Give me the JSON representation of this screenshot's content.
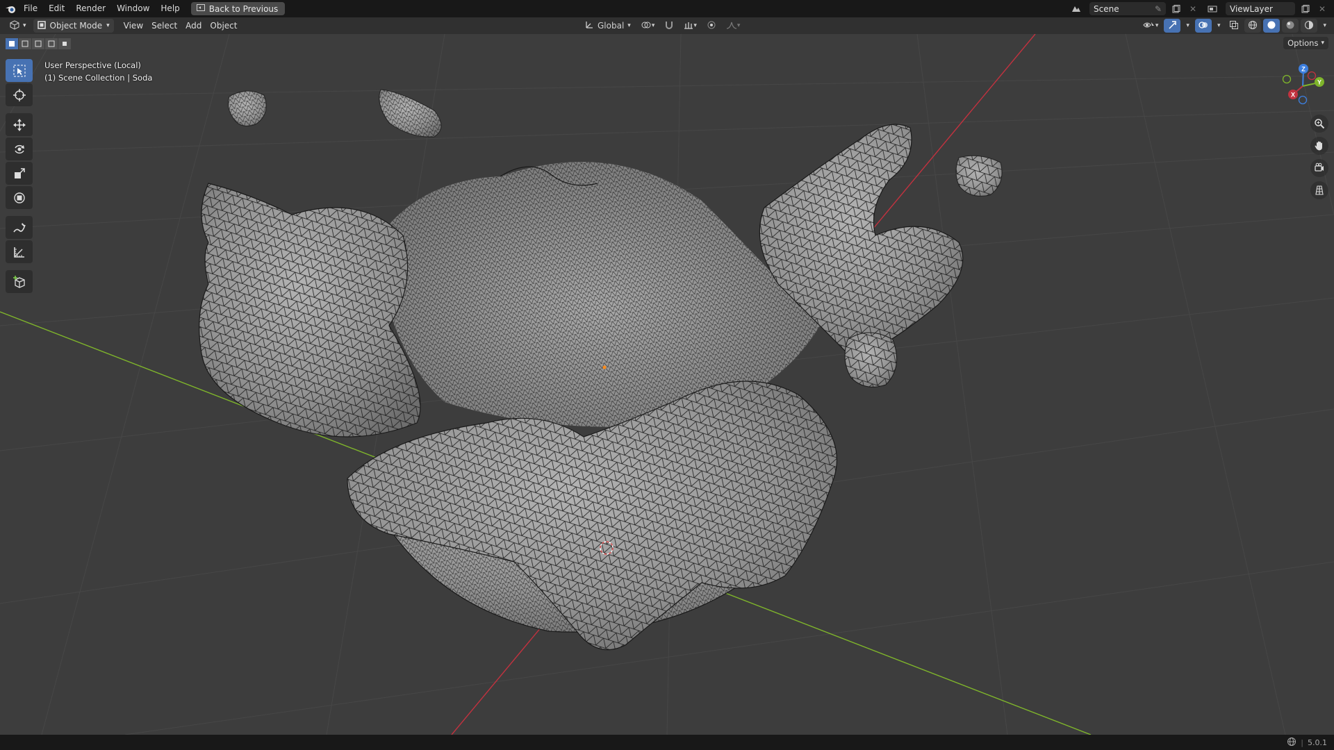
{
  "app": {
    "name": "Blender",
    "logo_icon": "blender-logo-icon"
  },
  "menu": [
    "File",
    "Edit",
    "Render",
    "Window",
    "Help"
  ],
  "back_button": {
    "label": "Back to Previous",
    "icon": "back-screen-icon"
  },
  "scene": {
    "name": "Scene"
  },
  "view_layer": {
    "name": "ViewLayer"
  },
  "viewport_header": {
    "editor_icon": "3d-viewport-icon",
    "mode": "Object Mode",
    "menus": [
      "View",
      "Select",
      "Add",
      "Object"
    ],
    "transform_orientation": "Global"
  },
  "overlay_info": {
    "view": "User Perspective (Local)",
    "collection": "(1) Scene Collection | Soda"
  },
  "options_label": "Options",
  "tools": [
    {
      "name": "select-box",
      "icon": "select-box-icon",
      "active": true
    },
    {
      "name": "cursor",
      "icon": "cursor-icon",
      "active": false
    },
    {
      "name": "move",
      "icon": "move-icon",
      "active": false
    },
    {
      "name": "rotate",
      "icon": "rotate-icon",
      "active": false
    },
    {
      "name": "scale",
      "icon": "scale-icon",
      "active": false
    },
    {
      "name": "transform",
      "icon": "transform-icon",
      "active": false
    },
    {
      "name": "annotate",
      "icon": "annotate-icon",
      "active": false
    },
    {
      "name": "measure",
      "icon": "measure-icon",
      "active": false
    },
    {
      "name": "add-cube",
      "icon": "add-cube-icon",
      "active": false
    }
  ],
  "gizmo": {
    "x": "X",
    "y": "Y",
    "z": "Z"
  },
  "status": {
    "version": "5.0.1"
  },
  "colors": {
    "accent": "#4772b3",
    "viewport_bg": "#3d3d3d",
    "x_axis": "#c2323f",
    "y_axis": "#7fb52b",
    "z_axis": "#3d7fdf",
    "mesh_fill": "#9a9a9a",
    "wire": "#1a1a1a"
  }
}
